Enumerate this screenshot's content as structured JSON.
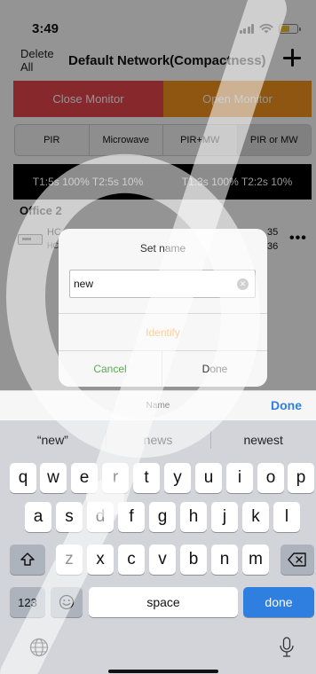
{
  "status_bar": {
    "time": "3:49"
  },
  "nav": {
    "delete_all": "Delete\nAll",
    "title": "Default Network(Compactness)",
    "add_icon": "plus-icon"
  },
  "monitor": {
    "close_label": "Close Monitor",
    "open_label": "Open Monitor",
    "close_color": "#e8464f",
    "open_color": "#f5941d"
  },
  "modes": {
    "items": [
      "PIR",
      "Microwave",
      "PIR+MW",
      "PIR or MW"
    ],
    "selected": "PIR or MW"
  },
  "timing": {
    "left": "T1:5s 100%  T2:5s 10%",
    "right": "T1:3s 100%  T2:2s 10%"
  },
  "group": {
    "label": "Office 2",
    "device": {
      "name": "HC",
      "sub": "HC",
      "num1": "35",
      "num2": "36",
      "more": "•••"
    }
  },
  "dialog": {
    "title": "Set name",
    "input_value": "new",
    "identify_label": "Identify",
    "cancel_label": "Cancel",
    "done_label": "Done",
    "identify_color": "#f5941d",
    "cancel_color": "#5aaa55"
  },
  "keyboard": {
    "accessory_name": "Name",
    "accessory_done": "Done",
    "suggestions": [
      "“new”",
      "news",
      "newest"
    ],
    "row1": [
      "q",
      "w",
      "e",
      "r",
      "t",
      "y",
      "u",
      "i",
      "o",
      "p"
    ],
    "row2": [
      "a",
      "s",
      "d",
      "f",
      "g",
      "h",
      "j",
      "k",
      "l"
    ],
    "row3": [
      "z",
      "x",
      "c",
      "v",
      "b",
      "n",
      "m"
    ],
    "numbers_label": "123",
    "space_label": "space",
    "return_label": "done",
    "accent_color": "#2f7fe0"
  }
}
